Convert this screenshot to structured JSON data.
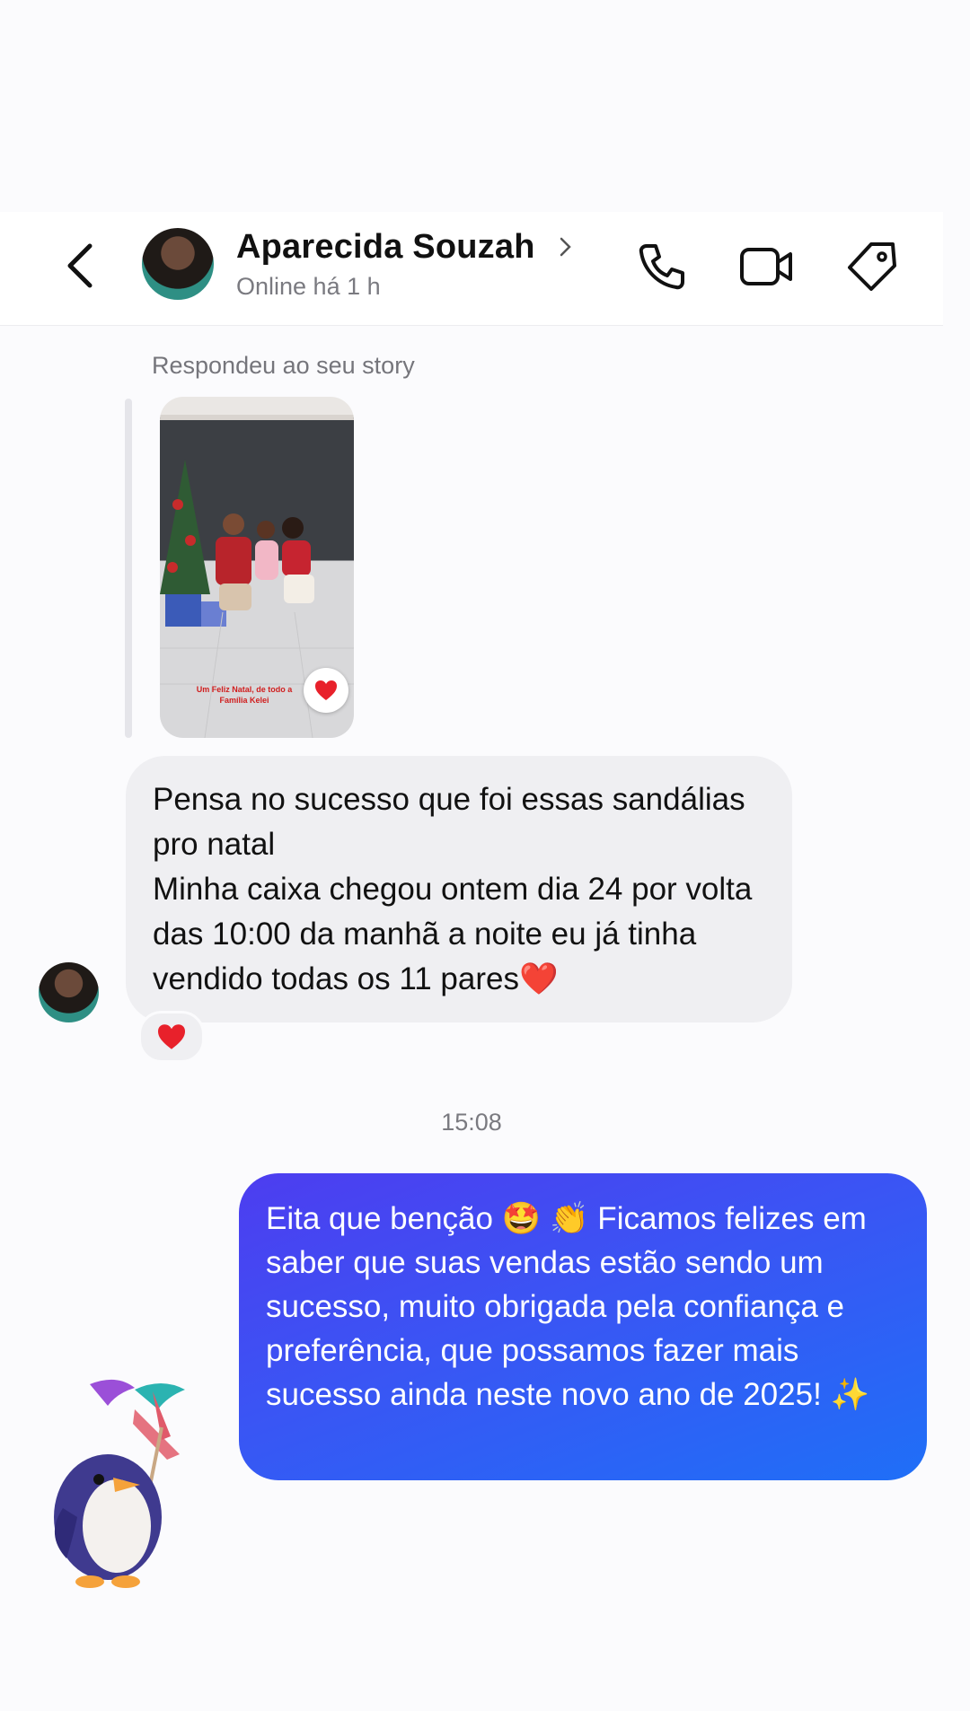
{
  "header": {
    "contact_name": "Aparecida Souzah",
    "status": "Online há 1 h",
    "icons": [
      "back-arrow-icon",
      "chevron-right-icon",
      "phone-icon",
      "video-camera-icon",
      "tag-icon"
    ]
  },
  "story_reply": {
    "label": "Respondeu ao seu story",
    "caption": "Um Feliz Natal, de todo a Família Kelei",
    "reaction": "❤️"
  },
  "incoming_message": {
    "lines": [
      "Pensa no sucesso que foi essas sandálias pro natal",
      "Minha caixa chegou ontem dia 24 por volta das 10:00 da manhã a noite eu já tinha vendido todas os 11 pares❤️"
    ],
    "reaction": "❤️"
  },
  "timestamp": "15:08",
  "outgoing_message": {
    "text": "Eita que benção 🤩 👏 Ficamos felizes em saber que suas vendas estão sendo um sucesso, muito obrigada pela confiança e preferência, que possamos fazer mais sucesso ainda neste novo ano de 2025! ✨"
  },
  "colors": {
    "outgoing_bubble": "#3a55f4",
    "incoming_bubble": "#efeff2",
    "heart": "#e8212b"
  }
}
